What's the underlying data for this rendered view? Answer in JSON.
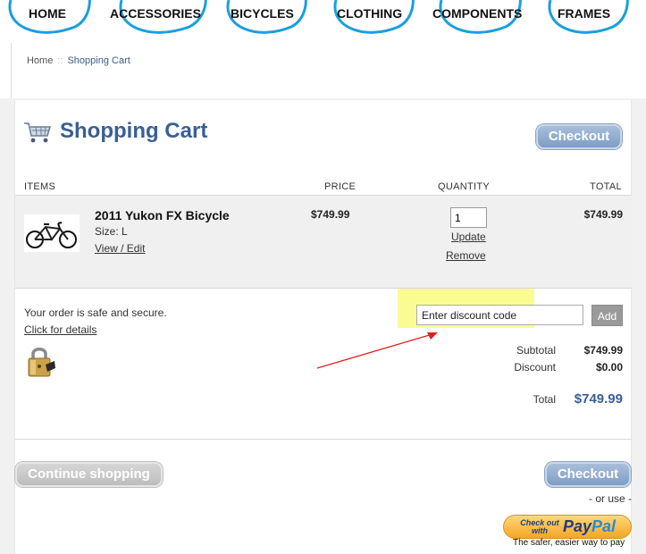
{
  "nav": {
    "items": [
      {
        "label": "HOME"
      },
      {
        "label": "ACCESSORIES"
      },
      {
        "label": "BICYCLES"
      },
      {
        "label": "CLOTHING"
      },
      {
        "label": "COMPONENTS"
      },
      {
        "label": "FRAMES"
      }
    ],
    "swoosh_color": "#1a9fe0"
  },
  "breadcrumb": {
    "home": "Home",
    "separator": "::",
    "current": "Shopping Cart"
  },
  "page": {
    "title": "Shopping Cart",
    "checkout_label": "Checkout",
    "accent": "#3a5f94"
  },
  "table": {
    "headers": {
      "items": "ITEMS",
      "price": "PRICE",
      "quantity": "QUANTITY",
      "total": "TOTAL"
    },
    "rows": [
      {
        "name": "2011 Yukon FX Bicycle",
        "size": "Size: L",
        "edit": "View / Edit",
        "price": "$749.99",
        "quantity": "1",
        "update": "Update",
        "remove": "Remove",
        "total": "$749.99"
      }
    ]
  },
  "secure": {
    "text": "Your order is safe and secure.",
    "link": "Click for details"
  },
  "discount": {
    "placeholder": "Enter discount code",
    "add_label": "Add",
    "highlight_color": "#fbfb8e"
  },
  "summary": {
    "subtotal_label": "Subtotal",
    "subtotal_value": "$749.99",
    "discount_label": "Discount",
    "discount_value": "$0.00",
    "total_label": "Total",
    "total_value": "$749.99"
  },
  "footer": {
    "continue_label": "Continue shopping",
    "checkout_label": "Checkout",
    "or_use": "- or use -",
    "paypal_small": "Check out with",
    "paypal_pay": "Pay",
    "paypal_pal": "Pal",
    "paypal_tagline": "The safer, easier way to pay"
  }
}
